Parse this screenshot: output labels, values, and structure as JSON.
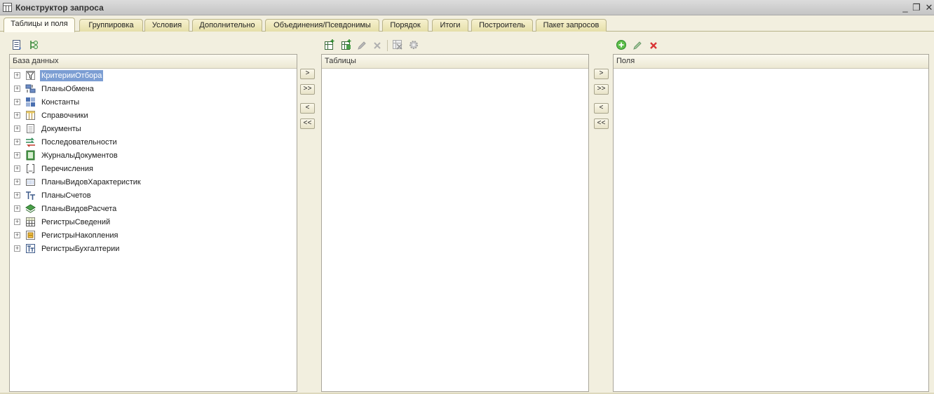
{
  "window": {
    "title": "Конструктор запроса"
  },
  "tabs": [
    {
      "label": "Таблицы и поля"
    },
    {
      "label": "Группировка"
    },
    {
      "label": "Условия"
    },
    {
      "label": "Дополнительно"
    },
    {
      "label": "Объединения/Псевдонимы"
    },
    {
      "label": "Порядок"
    },
    {
      "label": "Итоги"
    },
    {
      "label": "Построитель"
    },
    {
      "label": "Пакет запросов"
    }
  ],
  "database_panel": {
    "header": "База данных",
    "items": [
      {
        "label": "КритерииОтбора",
        "icon": "filter-icon",
        "selected": true
      },
      {
        "label": "ПланыОбмена",
        "icon": "exchange-plan-icon"
      },
      {
        "label": "Константы",
        "icon": "constants-icon"
      },
      {
        "label": "Справочники",
        "icon": "catalog-icon"
      },
      {
        "label": "Документы",
        "icon": "document-icon"
      },
      {
        "label": "Последовательности",
        "icon": "sequence-icon"
      },
      {
        "label": "ЖурналыДокументов",
        "icon": "document-journal-icon"
      },
      {
        "label": "Перечисления",
        "icon": "enum-icon"
      },
      {
        "label": "ПланыВидовХарактеристик",
        "icon": "characteristic-types-icon"
      },
      {
        "label": "ПланыСчетов",
        "icon": "chart-of-accounts-icon"
      },
      {
        "label": "ПланыВидовРасчета",
        "icon": "calculation-types-icon"
      },
      {
        "label": "РегистрыСведений",
        "icon": "info-register-icon"
      },
      {
        "label": "РегистрыНакопления",
        "icon": "accumulation-register-icon"
      },
      {
        "label": "РегистрыБухгалтерии",
        "icon": "accounting-register-icon"
      }
    ]
  },
  "tables_panel": {
    "header": "Таблицы"
  },
  "fields_panel": {
    "header": "Поля"
  },
  "move_buttons": {
    "add": ">",
    "add_all": ">>",
    "remove": "<",
    "remove_all": "<<"
  },
  "colors": {
    "selection": "#7c9ed3",
    "tab_active": "#fffdf4",
    "tab_inactive": "#e6dfa9",
    "background": "#f2efdf"
  }
}
